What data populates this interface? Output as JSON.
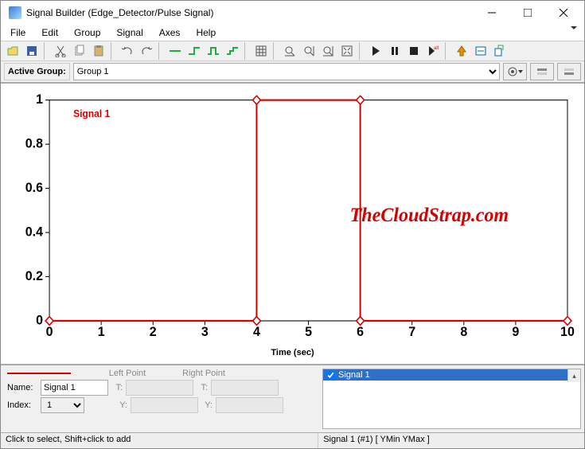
{
  "window": {
    "title": "Signal Builder (Edge_Detector/Pulse Signal)"
  },
  "menu": {
    "file": "File",
    "edit": "Edit",
    "group": "Group",
    "signal": "Signal",
    "axes": "Axes",
    "help": "Help"
  },
  "group": {
    "label": "Active Group:",
    "selected": "Group 1"
  },
  "chart_data": {
    "type": "line",
    "title": "Signal 1",
    "watermark": "TheCloudStrap.com",
    "xlabel": "Time (sec)",
    "ylabel": "",
    "xlim": [
      0,
      10
    ],
    "ylim": [
      0,
      1
    ],
    "xticks": [
      0,
      1,
      2,
      3,
      4,
      5,
      6,
      7,
      8,
      9,
      10
    ],
    "yticks": [
      0,
      0.2,
      0.4,
      0.6,
      0.8,
      1
    ],
    "series": [
      {
        "name": "Signal 1",
        "color": "#d60000",
        "x": [
          0,
          4,
          4,
          6,
          6,
          10
        ],
        "y": [
          0,
          0,
          1,
          1,
          0,
          0
        ]
      }
    ]
  },
  "editor": {
    "left_point": "Left Point",
    "right_point": "Right Point",
    "name_label": "Name:",
    "name_value": "Signal 1",
    "index_label": "Index:",
    "index_value": "1",
    "T": "T:",
    "Y": "Y:"
  },
  "signal_list": {
    "item1": "Signal 1"
  },
  "status": {
    "left": "Click to select, Shift+click to add",
    "right": "Signal 1 (#1)  [ YMin YMax ]"
  }
}
